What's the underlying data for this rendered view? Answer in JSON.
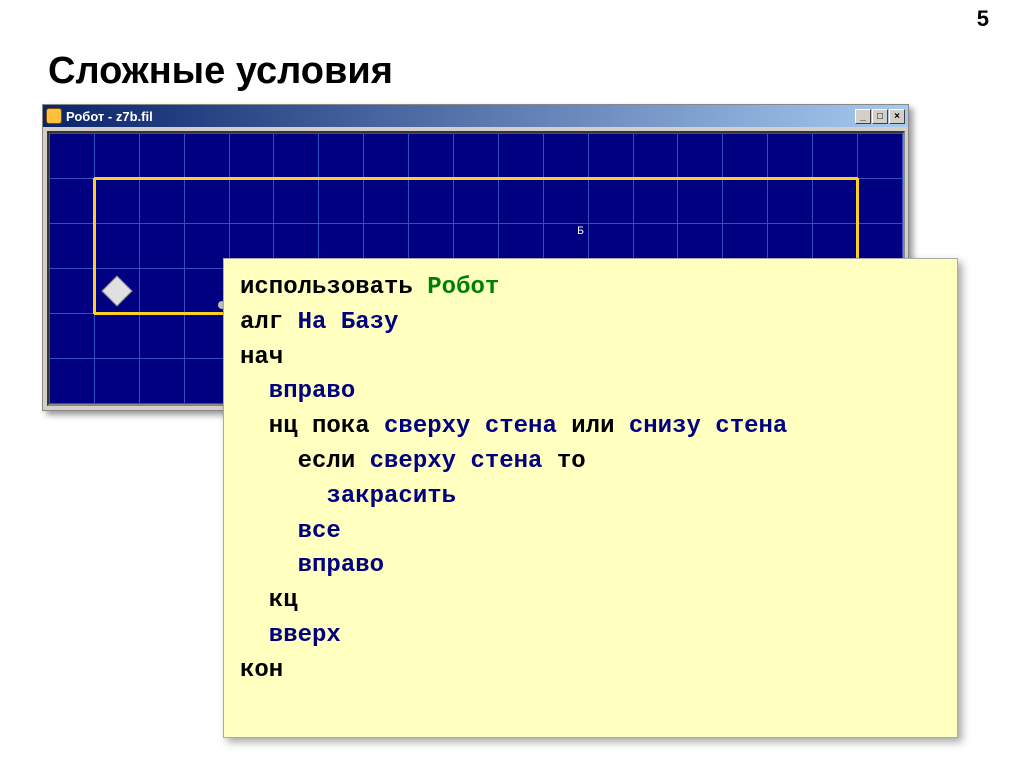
{
  "page_number": "5",
  "slide_title": "Сложные условия",
  "window": {
    "title": "Робот - z7b.fil",
    "buttons": {
      "min": "_",
      "max": "□",
      "close": "×"
    },
    "base_label": "Б"
  },
  "code": {
    "l1a": "использовать ",
    "l1b": "Робот",
    "l2a": "алг ",
    "l2b": "На Базу",
    "l3": "нач",
    "l4": "  вправо",
    "l5a": "  нц пока ",
    "l5b": "сверху стена",
    "l5c": " или ",
    "l5d": "снизу стена",
    "l6a": "    если ",
    "l6b": "сверху стена",
    "l6c": " то",
    "l7": "      закрасить",
    "l8": "    все",
    "l9": "    вправо",
    "l10": "  кц",
    "l11": "  вверх",
    "l12": "кон"
  }
}
